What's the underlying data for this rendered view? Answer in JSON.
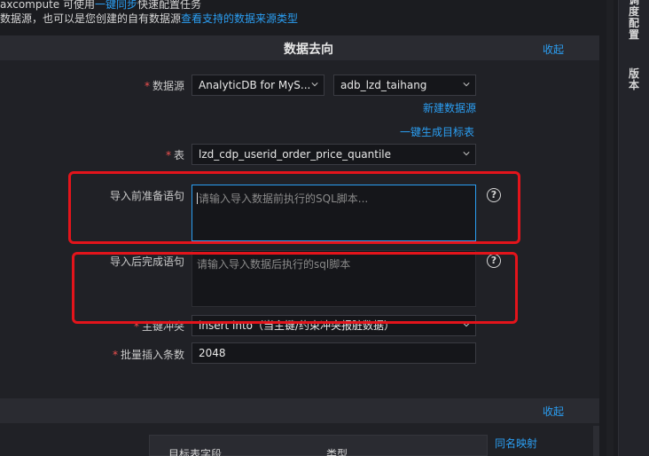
{
  "intro": {
    "line1_prefix": "axcompute 可使用",
    "line1_link": "一键同步",
    "line1_suffix": "快速配置任务",
    "line2_prefix": "数据源，也可以是您创建的自有数据源",
    "line2_link": "查看支持的数据来源类型"
  },
  "section_dest": {
    "title": "数据去向",
    "collapse_label": "收起"
  },
  "form": {
    "datasource_label": "数据源",
    "datasource_type": "AnalyticDB for MyS...",
    "datasource_name": "adb_lzd_taihang",
    "new_datasource_link": "新建数据源",
    "gen_target_table_link": "一键生成目标表",
    "table_label": "表",
    "table_value": "lzd_cdp_userid_order_price_quantile",
    "pre_sql_label": "导入前准备语句",
    "pre_sql_placeholder": "请输入导入数据前执行的SQL脚本...",
    "post_sql_label": "导入后完成语句",
    "post_sql_placeholder": "请输入导入数据后执行的sql脚本",
    "conflict_label": "主键冲突",
    "conflict_value": "insert into（当主键/约束冲突报脏数据）",
    "batch_label": "批量插入条数",
    "batch_value": "2048",
    "help_glyph": "?"
  },
  "section_mapping": {
    "collapse_label": "收起",
    "same_name_mapping": "同名映射",
    "col_target_field": "目标表字段",
    "col_type": "类型"
  },
  "sidebar": {
    "schedule_config": "调度配置",
    "version": "版本"
  },
  "colors": {
    "accent": "#2b9ef2",
    "required": "#f0504f",
    "highlight_box": "#e3141b"
  }
}
